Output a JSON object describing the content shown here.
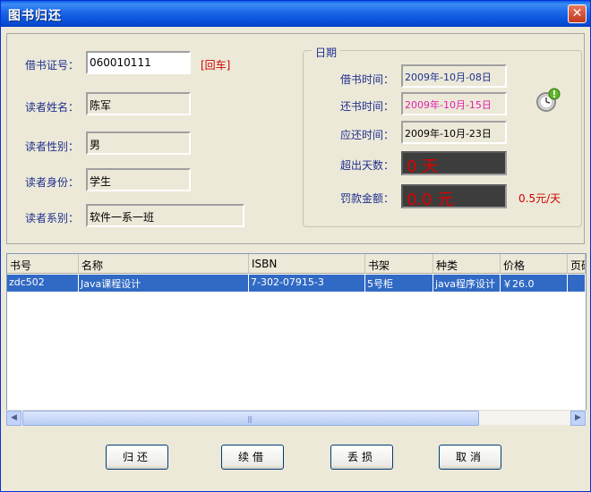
{
  "window": {
    "title": "图书归还",
    "close_glyph": "✕"
  },
  "form": {
    "card_no": {
      "label": "借书证号：",
      "value": "060010111",
      "hint": "[回车]"
    },
    "name": {
      "label": "读者姓名：",
      "value": "陈军"
    },
    "gender": {
      "label": "读者性别：",
      "value": "男"
    },
    "identity": {
      "label": "读者身份：",
      "value": "学生"
    },
    "department": {
      "label": "读者系别：",
      "value": "软件一系一班"
    }
  },
  "dates": {
    "group_title": "日期",
    "borrow": {
      "label": "借书时间：",
      "value": "2009年-10月-08日"
    },
    "return": {
      "label": "还书时间：",
      "value": "2009年-10月-15日"
    },
    "due": {
      "label": "应还时间：",
      "value": "2009年-10月-23日"
    },
    "overdue": {
      "label": "超出天数：",
      "value": "0  天"
    },
    "fine": {
      "label": "罚款金额：",
      "value": "0.0  元",
      "rate": "0.5元/天"
    }
  },
  "table": {
    "columns": [
      "书号",
      "名称",
      "ISBN",
      "书架",
      "种类",
      "价格",
      "页码"
    ],
    "rows": [
      [
        "zdc502",
        "Java课程设计",
        "7-302-07915-3",
        "5号柜",
        "java程序设计",
        "￥26.0",
        ""
      ]
    ]
  },
  "scrollbar": {
    "left_arrow": "◀",
    "right_arrow": "▶",
    "grip": "|||"
  },
  "buttons": {
    "return": "归还",
    "renew": "续借",
    "lost": "丢损",
    "cancel": "取消"
  },
  "colors": {
    "titlebar": "#0a5fe6",
    "selection": "#316ac5",
    "alert_red": "#e00000",
    "return_date": "#e01fae"
  }
}
